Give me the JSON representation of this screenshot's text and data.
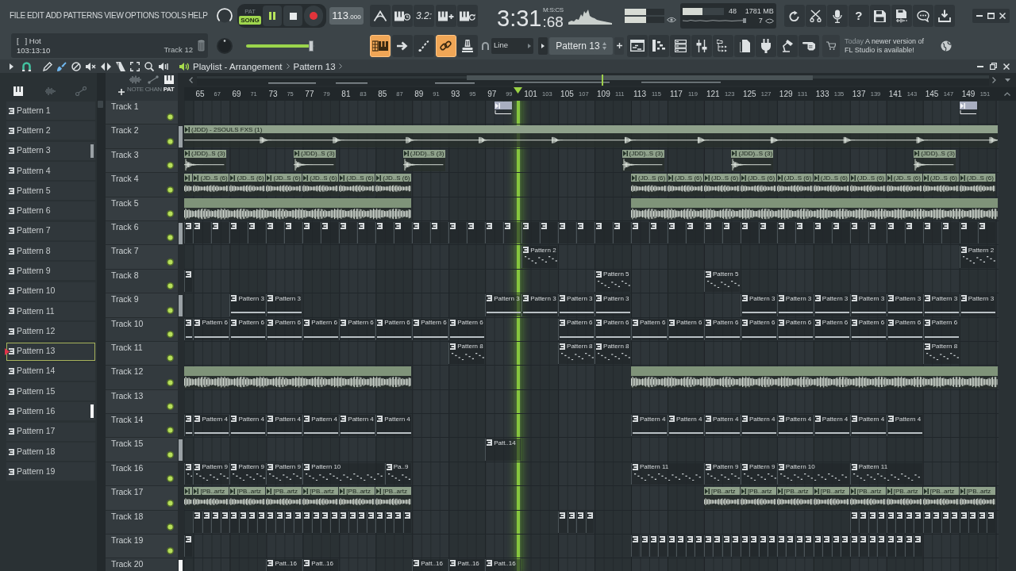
{
  "menu": [
    "FILE",
    "EDIT",
    "ADD",
    "PATTERNS",
    "VIEW",
    "OPTIONS",
    "TOOLS",
    "HELP"
  ],
  "transport": {
    "modes": [
      {
        "label": "PAT",
        "selected": false
      },
      {
        "label": "SONG",
        "selected": true
      }
    ],
    "playing": true,
    "recording": false,
    "tempo": "113",
    "tempo_fraction": ".000"
  },
  "countdown_label": "3.2:",
  "time": {
    "value": "3:31",
    "centiseconds": ":68",
    "format": "M:S:CS"
  },
  "output_meters": [
    {
      "level": 0.55
    },
    {
      "level": 0.55
    }
  ],
  "cpu": {
    "level": 0.48,
    "value": "48"
  },
  "memory": "1781 MB",
  "polyphony": "7",
  "help_label": "?",
  "hint": {
    "text": "[   ] Hot",
    "position": "103:13:10",
    "focus": "Track 12"
  },
  "position_slider": {
    "level": 0.95
  },
  "mode_buttons": [
    {
      "on": true
    },
    {
      "on": false
    },
    {
      "on": false
    },
    {
      "on": true
    },
    {
      "on": false
    }
  ],
  "snap": "Line",
  "pattern_selector": "Pattern 13",
  "news": {
    "date": "Today",
    "message": "A newer version of FL Studio is available!"
  },
  "playlist_window": {
    "title": "Playlist - Arrangement",
    "crumb": "Pattern 13",
    "tools": [
      {
        "selected": false
      },
      {
        "selected": true
      },
      {
        "selected": false
      },
      {
        "selected": false
      },
      {
        "selected": false
      },
      {
        "selected": false
      },
      {
        "selected": false
      },
      {
        "selected": false
      },
      {
        "selected": false
      }
    ]
  },
  "browser": {
    "filters": [
      {
        "selected": true
      },
      {
        "selected": false
      },
      {
        "selected": false
      }
    ],
    "patterns": [
      {
        "name": "Pattern 1",
        "selected": false
      },
      {
        "name": "Pattern 2",
        "selected": false
      },
      {
        "name": "Pattern 3",
        "selected": false,
        "marker": {
          "color": "#9aa1a5"
        }
      },
      {
        "name": "Pattern 4",
        "selected": false
      },
      {
        "name": "Pattern 5",
        "selected": false
      },
      {
        "name": "Pattern 6",
        "selected": false
      },
      {
        "name": "Pattern 7",
        "selected": false
      },
      {
        "name": "Pattern 8",
        "selected": false
      },
      {
        "name": "Pattern 9",
        "selected": false
      },
      {
        "name": "Pattern 10",
        "selected": false
      },
      {
        "name": "Pattern 11",
        "selected": false
      },
      {
        "name": "Pattern 12",
        "selected": false
      },
      {
        "name": "Pattern 13",
        "selected": true
      },
      {
        "name": "Pattern 14",
        "selected": false
      },
      {
        "name": "Pattern 15",
        "selected": false
      },
      {
        "name": "Pattern 16",
        "selected": false,
        "marker": {
          "color": "#f4f6f7"
        }
      },
      {
        "name": "Pattern 17",
        "selected": false
      },
      {
        "name": "Pattern 18",
        "selected": false
      },
      {
        "name": "Pattern 19",
        "selected": false
      }
    ]
  },
  "playlist": {
    "filters": [
      {
        "label": "NOTE",
        "selected": false
      },
      {
        "label": "CHAN",
        "selected": false
      },
      {
        "label": "PAT",
        "selected": true
      }
    ],
    "ruler": [
      "65",
      "67",
      "69",
      "71",
      "73",
      "75",
      "77",
      "79",
      "81",
      "83",
      "85",
      "87",
      "89",
      "91",
      "93",
      "95",
      "97",
      "99",
      "101",
      "103",
      "105",
      "107",
      "109",
      "111",
      "113",
      "115",
      "117",
      "119",
      "121",
      "123",
      "125",
      "127",
      "129",
      "131",
      "133",
      "135",
      "137",
      "139",
      "141",
      "143",
      "145",
      "147",
      "149",
      "151"
    ],
    "tracks": [
      {
        "name": "Track 1",
        "enabled": true,
        "clips": [
          {
            "kind": "automation"
          },
          {
            "kind": "automation"
          }
        ]
      },
      {
        "name": "Track 2",
        "enabled": true,
        "marker": {
          "color": "#9aa1a5"
        },
        "clips": [
          {
            "kind": "fx",
            "label": "(JDD) - 2SOULS FXS (1)"
          }
        ]
      },
      {
        "name": "Track 3",
        "enabled": true,
        "clips": [
          {
            "kind": "oneshot",
            "label": "(JDD)..S (3)"
          },
          {
            "kind": "oneshot",
            "label": "(JDD)..S (3)"
          },
          {
            "kind": "oneshot",
            "label": "(JDD)..S (3)"
          },
          {
            "kind": "oneshot",
            "label": "(JDD)..S (3)"
          },
          {
            "kind": "oneshot",
            "label": "(JDD)..S (3)"
          },
          {
            "kind": "oneshot",
            "label": "(JDD)..S (3)"
          }
        ]
      },
      {
        "name": "Track 4",
        "enabled": true,
        "clips": [
          {
            "kind": "loop"
          },
          {
            "kind": "loop",
            "label": "(JD..S (6)"
          },
          {
            "kind": "loop",
            "label": "(JD..S (6)"
          },
          {
            "kind": "loop",
            "label": "(JD..S (6)"
          },
          {
            "kind": "loop",
            "label": "(JD..S (6)"
          },
          {
            "kind": "loop",
            "label": "(JD..S (6)"
          },
          {
            "kind": "loop",
            "label": "(JD..S (6)"
          },
          {
            "kind": "loop",
            "label": "(JD..S (6)"
          },
          {
            "kind": "loop",
            "label": "(JD..S (6)"
          },
          {
            "kind": "loop",
            "label": "(JD..S (6)"
          },
          {
            "kind": "loop",
            "label": "(JD..S (6)"
          },
          {
            "kind": "loop",
            "label": "(JD..S (6)"
          },
          {
            "kind": "loop",
            "label": "(JD..S (6)"
          },
          {
            "kind": "loop",
            "label": "(JD..S (6)"
          },
          {
            "kind": "loop",
            "label": "(JD..S (6)"
          },
          {
            "kind": "loop",
            "label": "(JD..S (6)"
          },
          {
            "kind": "loop",
            "label": "(JD..S (6)"
          }
        ]
      },
      {
        "name": "Track 5",
        "enabled": true,
        "clips": [
          {
            "kind": "stem"
          },
          {
            "kind": "stem"
          }
        ]
      },
      {
        "name": "Track 6",
        "enabled": true,
        "marker": {
          "color": "#9aa1a5"
        },
        "clips": [
          {
            "kind": "pattern"
          },
          {
            "kind": "pattern"
          },
          {
            "kind": "pattern"
          },
          {
            "kind": "pattern"
          },
          {
            "kind": "pattern"
          },
          {
            "kind": "pattern"
          },
          {
            "kind": "pattern"
          },
          {
            "kind": "pattern"
          },
          {
            "kind": "pattern"
          },
          {
            "kind": "pattern"
          },
          {
            "kind": "pattern"
          },
          {
            "kind": "pattern"
          },
          {
            "kind": "pattern"
          },
          {
            "kind": "pattern"
          },
          {
            "kind": "pattern"
          },
          {
            "kind": "pattern"
          },
          {
            "kind": "pattern"
          },
          {
            "kind": "pattern"
          },
          {
            "kind": "pattern"
          },
          {
            "kind": "pattern"
          },
          {
            "kind": "pattern"
          },
          {
            "kind": "pattern"
          },
          {
            "kind": "pattern"
          },
          {
            "kind": "pattern"
          },
          {
            "kind": "pattern"
          },
          {
            "kind": "pattern"
          },
          {
            "kind": "pattern"
          },
          {
            "kind": "pattern"
          },
          {
            "kind": "pattern"
          },
          {
            "kind": "pattern"
          },
          {
            "kind": "pattern"
          },
          {
            "kind": "pattern"
          },
          {
            "kind": "pattern"
          },
          {
            "kind": "pattern"
          },
          {
            "kind": "pattern"
          },
          {
            "kind": "pattern"
          },
          {
            "kind": "pattern"
          },
          {
            "kind": "pattern"
          },
          {
            "kind": "pattern"
          },
          {
            "kind": "pattern"
          },
          {
            "kind": "pattern"
          },
          {
            "kind": "pattern"
          },
          {
            "kind": "pattern"
          },
          {
            "kind": "pattern"
          },
          {
            "kind": "pattern"
          }
        ]
      },
      {
        "name": "Track 7",
        "enabled": true,
        "clips": [
          {
            "kind": "melody",
            "label": "Pattern 2"
          },
          {
            "kind": "melody",
            "label": "Pattern 2"
          }
        ]
      },
      {
        "name": "Track 8",
        "enabled": true,
        "clips": [
          {
            "kind": "pattern"
          },
          {
            "kind": "melody",
            "label": "Pattern 5"
          },
          {
            "kind": "melody",
            "label": "Pattern 5"
          }
        ]
      },
      {
        "name": "Track 9",
        "enabled": true,
        "marker": {
          "color": "#9aa1a5"
        },
        "clips": [
          {
            "kind": "sustain",
            "label": "Pattern 3"
          },
          {
            "kind": "sustain",
            "label": "Pattern 3"
          },
          {
            "kind": "sustain",
            "label": "Pattern 3"
          },
          {
            "kind": "sustain",
            "label": "Pattern 3"
          },
          {
            "kind": "sustain",
            "label": "Pattern 3"
          },
          {
            "kind": "sustain",
            "label": "Pattern 3"
          },
          {
            "kind": "sustain",
            "label": "Pattern 3"
          },
          {
            "kind": "sustain",
            "label": "Pattern 3"
          },
          {
            "kind": "sustain",
            "label": "Pattern 3"
          },
          {
            "kind": "sustain",
            "label": "Pattern 3"
          },
          {
            "kind": "sustain",
            "label": "Pattern 3"
          },
          {
            "kind": "sustain",
            "label": "Pattern 3"
          },
          {
            "kind": "sustain",
            "label": "Pattern 3"
          }
        ]
      },
      {
        "name": "Track 10",
        "enabled": true,
        "clips": [
          {
            "kind": "sustain"
          },
          {
            "kind": "sustain",
            "label": "Pattern 6"
          },
          {
            "kind": "sustain",
            "label": "Pattern 6"
          },
          {
            "kind": "sustain",
            "label": "Pattern 6"
          },
          {
            "kind": "sustain",
            "label": "Pattern 6"
          },
          {
            "kind": "sustain",
            "label": "Pattern 6"
          },
          {
            "kind": "sustain",
            "label": "Pattern 6"
          },
          {
            "kind": "sustain",
            "label": "Pattern 6"
          },
          {
            "kind": "sustain",
            "label": "Pattern 6"
          },
          {
            "kind": "sustain",
            "label": "Pattern 6"
          },
          {
            "kind": "sustain",
            "label": "Pattern 6"
          },
          {
            "kind": "sustain",
            "label": "Pattern 6"
          },
          {
            "kind": "sustain",
            "label": "Pattern 6"
          },
          {
            "kind": "sustain",
            "label": "Pattern 6"
          },
          {
            "kind": "sustain",
            "label": "Pattern 6"
          },
          {
            "kind": "sustain",
            "label": "Pattern 6"
          },
          {
            "kind": "sustain",
            "label": "Pattern 6"
          },
          {
            "kind": "sustain",
            "label": "Pattern 6"
          },
          {
            "kind": "sustain",
            "label": "Pattern 6"
          },
          {
            "kind": "sustain",
            "label": "Pattern 6"
          }
        ]
      },
      {
        "name": "Track 11",
        "enabled": true,
        "clips": [
          {
            "kind": "melody",
            "label": "Pattern 8"
          },
          {
            "kind": "melody",
            "label": "Pattern 8"
          },
          {
            "kind": "melody",
            "label": "Pattern 8"
          },
          {
            "kind": "melody",
            "label": "Pattern 8"
          }
        ]
      },
      {
        "name": "Track 12",
        "enabled": true,
        "clips": [
          {
            "kind": "stem"
          },
          {
            "kind": "stem"
          }
        ]
      },
      {
        "name": "Track 13",
        "enabled": true
      },
      {
        "name": "Track 14",
        "enabled": true,
        "clips": [
          {
            "kind": "sustain"
          },
          {
            "kind": "sustain",
            "label": "Pattern 4"
          },
          {
            "kind": "sustain",
            "label": "Pattern 4"
          },
          {
            "kind": "sustain",
            "label": "Pattern 4"
          },
          {
            "kind": "sustain",
            "label": "Pattern 4"
          },
          {
            "kind": "sustain",
            "label": "Pattern 4"
          },
          {
            "kind": "sustain",
            "label": "Pattern 4"
          },
          {
            "kind": "sustain",
            "label": "Pattern 4"
          },
          {
            "kind": "sustain",
            "label": "Pattern 4"
          },
          {
            "kind": "sustain",
            "label": "Pattern 4"
          },
          {
            "kind": "sustain",
            "label": "Pattern 4"
          },
          {
            "kind": "sustain",
            "label": "Pattern 4"
          },
          {
            "kind": "sustain",
            "label": "Pattern 4"
          },
          {
            "kind": "sustain",
            "label": "Pattern 4"
          },
          {
            "kind": "sustain",
            "label": "Pattern 4"
          }
        ]
      },
      {
        "name": "Track 15",
        "enabled": true,
        "marker": {
          "color": "#9aa1a5"
        },
        "clips": [
          {
            "kind": "pattern",
            "label": "Patt..14"
          }
        ]
      },
      {
        "name": "Track 16",
        "enabled": true,
        "clips": [
          {
            "kind": "melody"
          },
          {
            "kind": "melody",
            "label": "Pattern 9"
          },
          {
            "kind": "melody",
            "label": "Pattern 9"
          },
          {
            "kind": "melody",
            "label": "Pattern 9"
          },
          {
            "kind": "melody",
            "label": "Pattern 10"
          },
          {
            "kind": "melody",
            "label": "Pa..9"
          },
          {
            "kind": "melody",
            "label": "Pattern 11"
          },
          {
            "kind": "melody",
            "label": "Pattern 9"
          },
          {
            "kind": "melody",
            "label": "Pattern 9"
          },
          {
            "kind": "melody",
            "label": "Pattern 10"
          },
          {
            "kind": "melody",
            "label": "Pattern 11"
          }
        ]
      },
      {
        "name": "Track 17",
        "enabled": true,
        "clips": [
          {
            "kind": "loop"
          },
          {
            "kind": "loop",
            "label": "[PB..artz"
          },
          {
            "kind": "loop",
            "label": "[PB..artz"
          },
          {
            "kind": "loop",
            "label": "[PB..artz"
          },
          {
            "kind": "loop",
            "label": "[PB..artz"
          },
          {
            "kind": "loop",
            "label": "[PB..artz"
          },
          {
            "kind": "loop",
            "label": "[PB..artz"
          },
          {
            "kind": "loop",
            "label": "[PB..artz"
          },
          {
            "kind": "loop",
            "label": "[PB..artz"
          },
          {
            "kind": "loop",
            "label": "[PB..artz"
          },
          {
            "kind": "loop",
            "label": "[PB..artz"
          },
          {
            "kind": "loop",
            "label": "[PB..artz"
          },
          {
            "kind": "loop",
            "label": "[PB..artz"
          },
          {
            "kind": "loop",
            "label": "[PB..artz"
          },
          {
            "kind": "loop",
            "label": "[PB..artz"
          }
        ]
      },
      {
        "name": "Track 18",
        "enabled": true,
        "clips": [
          {
            "kind": "pattern"
          },
          {
            "kind": "pattern"
          },
          {
            "kind": "pattern"
          },
          {
            "kind": "pattern"
          },
          {
            "kind": "pattern"
          },
          {
            "kind": "pattern"
          },
          {
            "kind": "pattern"
          },
          {
            "kind": "pattern"
          },
          {
            "kind": "pattern"
          },
          {
            "kind": "pattern"
          },
          {
            "kind": "pattern"
          },
          {
            "kind": "pattern"
          },
          {
            "kind": "pattern"
          },
          {
            "kind": "pattern"
          },
          {
            "kind": "pattern"
          },
          {
            "kind": "pattern"
          },
          {
            "kind": "pattern"
          },
          {
            "kind": "pattern"
          },
          {
            "kind": "pattern"
          },
          {
            "kind": "pattern"
          },
          {
            "kind": "pattern"
          },
          {
            "kind": "pattern"
          },
          {
            "kind": "pattern"
          },
          {
            "kind": "pattern"
          },
          {
            "kind": "pattern"
          },
          {
            "kind": "pattern"
          },
          {
            "kind": "pattern"
          },
          {
            "kind": "pattern"
          },
          {
            "kind": "pattern"
          },
          {
            "kind": "pattern"
          },
          {
            "kind": "pattern"
          },
          {
            "kind": "pattern"
          },
          {
            "kind": "pattern"
          },
          {
            "kind": "pattern"
          },
          {
            "kind": "pattern"
          },
          {
            "kind": "pattern"
          },
          {
            "kind": "pattern"
          },
          {
            "kind": "pattern"
          },
          {
            "kind": "pattern"
          },
          {
            "kind": "pattern"
          },
          {
            "kind": "pattern"
          },
          {
            "kind": "pattern"
          },
          {
            "kind": "pattern"
          },
          {
            "kind": "pattern"
          }
        ]
      },
      {
        "name": "Track 19",
        "enabled": true,
        "clips": [
          {
            "kind": "pattern"
          },
          {
            "kind": "pattern"
          },
          {
            "kind": "pattern"
          },
          {
            "kind": "pattern"
          },
          {
            "kind": "pattern"
          },
          {
            "kind": "pattern"
          },
          {
            "kind": "pattern"
          },
          {
            "kind": "pattern"
          },
          {
            "kind": "pattern"
          },
          {
            "kind": "pattern"
          },
          {
            "kind": "pattern"
          },
          {
            "kind": "pattern"
          },
          {
            "kind": "pattern"
          },
          {
            "kind": "pattern"
          },
          {
            "kind": "pattern"
          },
          {
            "kind": "pattern"
          },
          {
            "kind": "pattern"
          },
          {
            "kind": "pattern"
          },
          {
            "kind": "pattern"
          },
          {
            "kind": "pattern"
          },
          {
            "kind": "pattern"
          },
          {
            "kind": "pattern"
          },
          {
            "kind": "pattern"
          },
          {
            "kind": "pattern"
          },
          {
            "kind": "pattern"
          },
          {
            "kind": "pattern"
          },
          {
            "kind": "pattern"
          },
          {
            "kind": "pattern"
          },
          {
            "kind": "pattern"
          },
          {
            "kind": "pattern"
          },
          {
            "kind": "pattern"
          },
          {
            "kind": "pattern"
          },
          {
            "kind": "pattern"
          }
        ]
      },
      {
        "name": "Track 20",
        "marker": {
          "color": "#f4f6f7"
        },
        "clips": [
          {
            "kind": "pattern",
            "label": "Patt..16"
          },
          {
            "kind": "pattern",
            "label": "Patt..16"
          },
          {
            "kind": "pattern",
            "label": "Patt..16"
          },
          {
            "kind": "pattern",
            "label": "Patt..16"
          },
          {
            "kind": "pattern",
            "label": "Patt..16"
          }
        ]
      }
    ]
  }
}
